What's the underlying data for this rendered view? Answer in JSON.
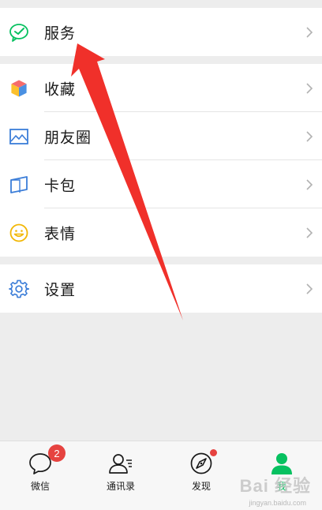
{
  "menu": {
    "services": {
      "label": "服务",
      "icon": "wechat-pay-check-icon"
    },
    "favorites": {
      "label": "收藏",
      "icon": "cube-icon"
    },
    "moments": {
      "label": "朋友圈",
      "icon": "image-icon"
    },
    "cards": {
      "label": "卡包",
      "icon": "card-icon"
    },
    "stickers": {
      "label": "表情",
      "icon": "smiley-icon"
    },
    "settings": {
      "label": "设置",
      "icon": "gear-icon"
    }
  },
  "tabbar": {
    "chats": {
      "label": "微信",
      "badge": "2",
      "icon": "chat-bubble-icon"
    },
    "contacts": {
      "label": "通讯录",
      "icon": "contacts-icon"
    },
    "discover": {
      "label": "发现",
      "icon": "compass-icon"
    },
    "me": {
      "label": "我",
      "icon": "person-icon",
      "active": true
    }
  },
  "watermark": {
    "text": "Bai 经验",
    "sub": "jingyan.baidu.com"
  },
  "colors": {
    "accent": "#07c160",
    "badge": "#e64340",
    "arrow": "#f0302a"
  }
}
